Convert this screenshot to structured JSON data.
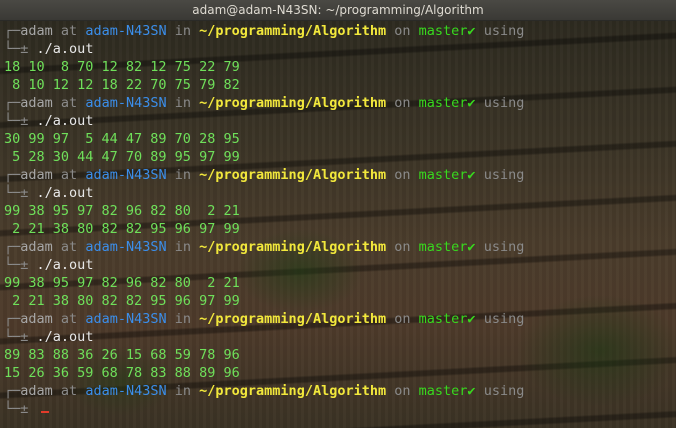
{
  "window": {
    "title": "adam@adam-N43SN: ~/programming/Algorithm"
  },
  "prompt": {
    "frame_top": "┌─",
    "frame_bottom": "└─",
    "user": "adam",
    "at": "at",
    "host": "adam-N43SN",
    "in": "in",
    "path": "~/programming/Algorithm",
    "on": "on",
    "branch": "master",
    "status_glyph": "✔",
    "using": "using",
    "symbol": "±"
  },
  "command": "./a.out",
  "runs": [
    {
      "input": "18 10  8 70 12 82 12 75 22 79",
      "sorted": " 8 10 12 12 18 22 70 75 79 82"
    },
    {
      "input": "30 99 97  5 44 47 89 70 28 95",
      "sorted": " 5 28 30 44 47 70 89 95 97 99"
    },
    {
      "input": "99 38 95 97 82 96 82 80  2 21",
      "sorted": " 2 21 38 80 82 82 95 96 97 99"
    },
    {
      "input": "99 38 95 97 82 96 82 80  2 21",
      "sorted": " 2 21 38 80 82 82 95 96 97 99"
    },
    {
      "input": "89 83 88 36 26 15 68 59 78 96",
      "sorted": "15 26 36 59 68 78 83 88 89 96"
    }
  ],
  "colors": {
    "path": "#f2e83c",
    "host": "#3b8eea",
    "branch": "#38d81e",
    "output": "#6fe05a",
    "cursor": "#e23b2a"
  }
}
